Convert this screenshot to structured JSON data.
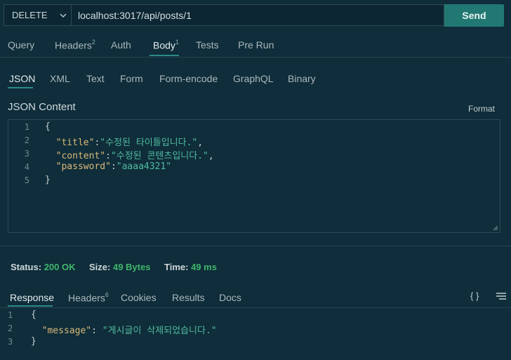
{
  "request": {
    "method": "DELETE",
    "url": "localhost:3017/api/posts/1",
    "send_label": "Send"
  },
  "request_tabs": [
    {
      "label": "Query",
      "badge": ""
    },
    {
      "label": "Headers",
      "badge": "2"
    },
    {
      "label": "Auth",
      "badge": ""
    },
    {
      "label": "Body",
      "badge": "1"
    },
    {
      "label": "Tests",
      "badge": ""
    },
    {
      "label": "Pre Run",
      "badge": ""
    }
  ],
  "active_request_tab": "Body",
  "body_types": [
    "JSON",
    "XML",
    "Text",
    "Form",
    "Form-encode",
    "GraphQL",
    "Binary"
  ],
  "active_body_type": "JSON",
  "content_label": "JSON Content",
  "format_label": "Format",
  "editor": {
    "line_numbers": [
      "1",
      "2",
      "3",
      "4",
      "5"
    ],
    "line1": "{",
    "title_key": "\"title\"",
    "title_val": "\"수정된 타이틀입니다.\"",
    "content_key": "\"content\"",
    "content_val": "\"수정된 콘텐츠입니다.\"",
    "password_key": "\"password\"",
    "password_val": "\"aaaa4321\"",
    "line5": "}"
  },
  "status": {
    "status_label": "Status:",
    "status_value": "200 OK",
    "size_label": "Size:",
    "size_value": "49 Bytes",
    "time_label": "Time:",
    "time_value": "49 ms"
  },
  "response_tabs": [
    {
      "label": "Response",
      "badge": ""
    },
    {
      "label": "Headers",
      "badge": "6"
    },
    {
      "label": "Cookies",
      "badge": ""
    },
    {
      "label": "Results",
      "badge": ""
    },
    {
      "label": "Docs",
      "badge": ""
    }
  ],
  "active_response_tab": "Response",
  "response_icons": {
    "braces": "{ }",
    "menu": "menu-icon"
  },
  "response": {
    "line_numbers": [
      "1",
      "2",
      "3"
    ],
    "line1": "{",
    "message_key": "\"message\"",
    "message_val": "\"게시글이 삭제되었습니다.\"",
    "line3": "}"
  },
  "colors": {
    "background": "#0f2d3a",
    "accent": "#217872",
    "success": "#3fb66b"
  }
}
